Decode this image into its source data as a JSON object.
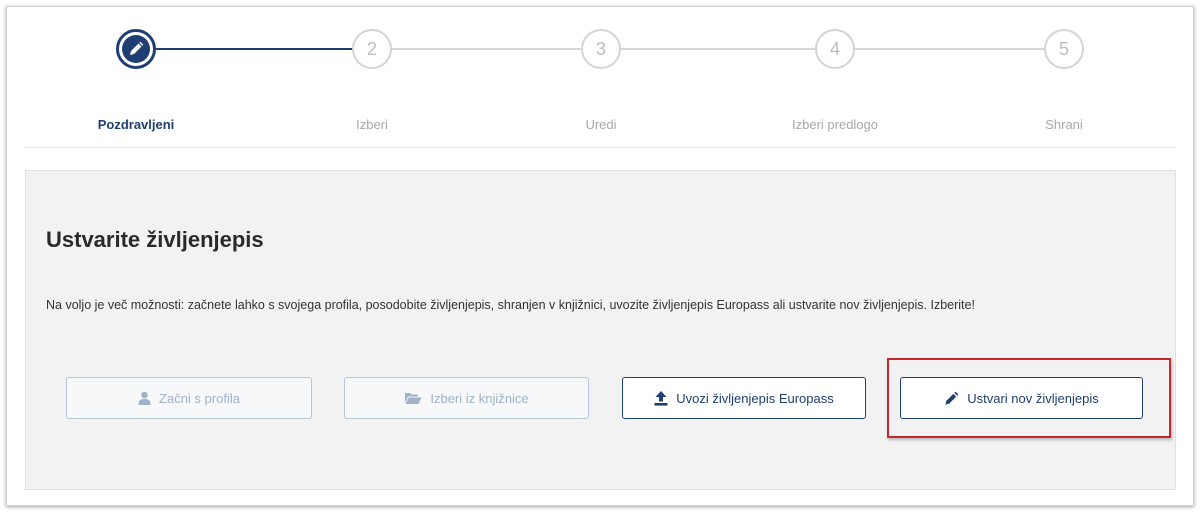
{
  "stepper": {
    "steps": [
      {
        "number": "",
        "label": "Pozdravljeni",
        "active": true
      },
      {
        "number": "2",
        "label": "Izberi",
        "active": false
      },
      {
        "number": "3",
        "label": "Uredi",
        "active": false
      },
      {
        "number": "4",
        "label": "Izberi predlogo",
        "active": false
      },
      {
        "number": "5",
        "label": "Shrani",
        "active": false
      }
    ]
  },
  "panel": {
    "title": "Ustvarite življenjepis",
    "description": "Na voljo je več možnosti: začnete lahko s svojega profila, posodobite življenjepis, shranjen v knjižnici, uvozite življenjepis Europass ali ustvarite nov življenjepis. Izberite!"
  },
  "buttons": {
    "from_profile": {
      "label": "Začni s profila",
      "icon": "user-icon",
      "enabled": false
    },
    "from_library": {
      "label": "Izberi iz knjižnice",
      "icon": "folder-open-icon",
      "enabled": false
    },
    "import_europass": {
      "label": "Uvozi življenjepis Europass",
      "icon": "upload-icon",
      "enabled": true
    },
    "create_new": {
      "label": "Ustvari nov življenjepis",
      "icon": "pencil-icon",
      "enabled": true
    }
  },
  "colors": {
    "primary": "#1f3f73",
    "disabled": "#9fb2c9",
    "highlight": "#c4262e",
    "panel_bg": "#f2f2f2"
  }
}
